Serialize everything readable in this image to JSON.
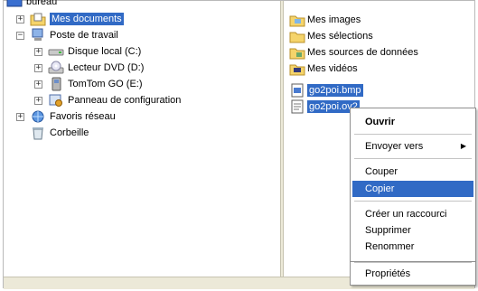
{
  "tree": {
    "top_item": "bureau",
    "items": [
      {
        "label": "Mes documents",
        "expander": "+",
        "icon": "folder-documents-icon",
        "selected": true
      },
      {
        "label": "Poste de travail",
        "expander": "−",
        "icon": "computer-icon"
      },
      {
        "label": "Disque local (C:)",
        "expander": "+",
        "icon": "hard-drive-icon"
      },
      {
        "label": "Lecteur DVD (D:)",
        "expander": "+",
        "icon": "dvd-drive-icon"
      },
      {
        "label": "TomTom GO (E:)",
        "expander": "+",
        "icon": "removable-drive-icon"
      },
      {
        "label": "Panneau de configuration",
        "expander": "+",
        "icon": "control-panel-icon"
      },
      {
        "label": "Favoris réseau",
        "expander": "+",
        "icon": "network-icon"
      },
      {
        "label": "Corbeille",
        "expander": "",
        "icon": "recycle-bin-icon"
      }
    ]
  },
  "files": [
    {
      "label": "Mes images",
      "icon": "folder-images-icon",
      "selected": false
    },
    {
      "label": "Mes sélections",
      "icon": "folder-icon",
      "selected": false
    },
    {
      "label": "Mes sources de données",
      "icon": "data-sources-icon",
      "selected": false
    },
    {
      "label": "Mes vidéos",
      "icon": "folder-videos-icon",
      "selected": false
    },
    {
      "label": "go2poi.bmp",
      "icon": "bitmap-file-icon",
      "selected": true
    },
    {
      "label": "go2poi.ov2",
      "icon": "ov2-file-icon",
      "selected": true
    }
  ],
  "context_menu": {
    "items": [
      {
        "label": "Ouvrir",
        "bold": true
      },
      {
        "label": "Envoyer vers",
        "submenu": true
      },
      {
        "label": "Couper"
      },
      {
        "label": "Copier",
        "highlighted": true
      },
      {
        "label": "Créer un raccourci"
      },
      {
        "label": "Supprimer"
      },
      {
        "label": "Renommer"
      },
      {
        "label": "Propriétés"
      }
    ],
    "submenu_arrow": "▶"
  },
  "colors": {
    "selection": "#316ac5",
    "chrome": "#ece9d8"
  }
}
